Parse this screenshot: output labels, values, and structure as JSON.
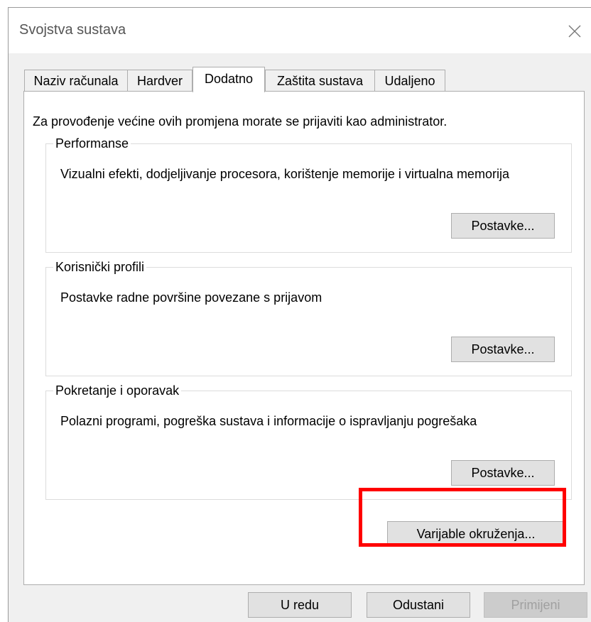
{
  "window": {
    "title": "Svojstva sustava",
    "close_icon": "close-icon"
  },
  "tabs": [
    {
      "label": "Naziv računala",
      "active": false
    },
    {
      "label": "Hardver",
      "active": false
    },
    {
      "label": "Dodatno",
      "active": true
    },
    {
      "label": "Zaštita sustava",
      "active": false
    },
    {
      "label": "Udaljeno",
      "active": false
    }
  ],
  "panel": {
    "intro": "Za provođenje većine ovih promjena morate se prijaviti kao administrator.",
    "groups": [
      {
        "title": "Performanse",
        "description": "Vizualni efekti, dodjeljivanje procesora, korištenje memorije i virtualna memorija",
        "button": "Postavke..."
      },
      {
        "title": "Korisnički profili",
        "description": "Postavke radne površine povezane s prijavom",
        "button": "Postavke..."
      },
      {
        "title": "Pokretanje i oporavak",
        "description": "Polazni programi, pogreška sustava i informacije o ispravljanju pogrešaka",
        "button": "Postavke..."
      }
    ],
    "env_button": "Varijable okruženja..."
  },
  "footer": {
    "ok": "U redu",
    "cancel": "Odustani",
    "apply": "Primijeni",
    "apply_disabled": true
  },
  "colors": {
    "highlight": "#ff0000",
    "dialog_bg": "#f0f0f0",
    "button_bg": "#e1e1e1"
  }
}
